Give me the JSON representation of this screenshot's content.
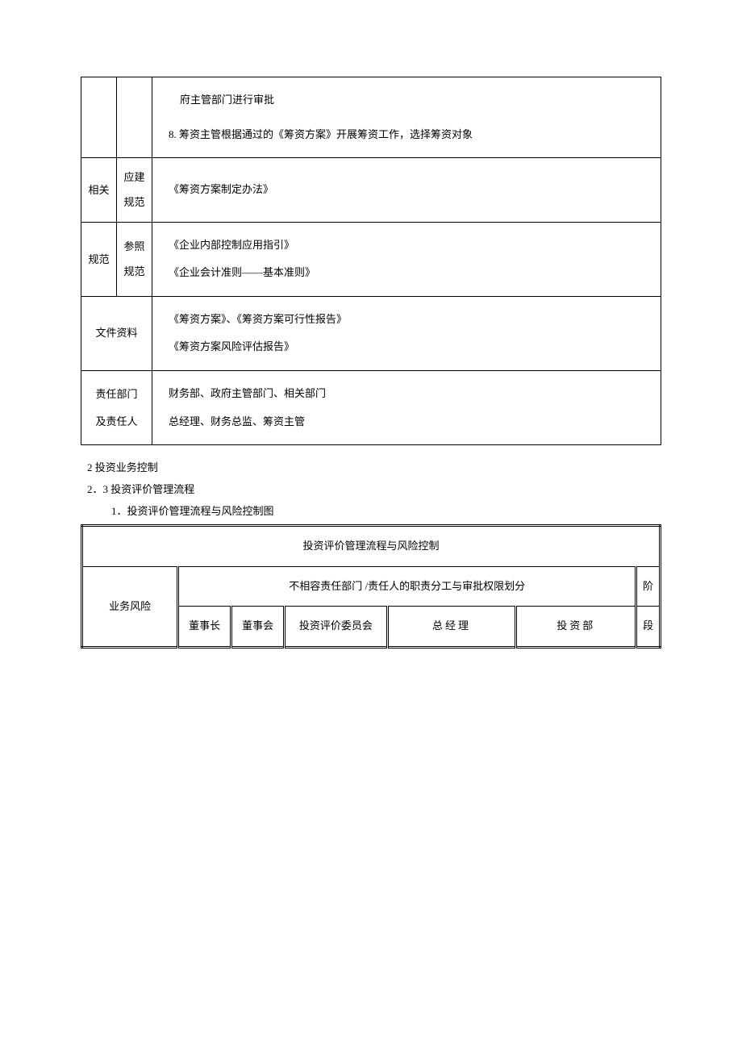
{
  "table1": {
    "row1": {
      "line1": "府主管部门进行审批",
      "line2": "8.  筹资主管根据通过的《筹资方案》开展筹资工作，选择筹资对象"
    },
    "row2": {
      "catA": "相关",
      "catB": "应建规范",
      "content": "《筹资方案制定办法》"
    },
    "row3": {
      "catA": "规范",
      "catB": "参照规范",
      "line1": "《企业内部控制应用指引》",
      "line2": "《企业会计准则——基本准则》"
    },
    "row4": {
      "label": "文件资料",
      "line1": "《筹资方案》、《筹资方案可行性报告》",
      "line2": "《筹资方案风险评估报告》"
    },
    "row5": {
      "label1": "责任部门",
      "content1": "财务部、政府主管部门、相关部门",
      "label2": "及责任人",
      "content2": "总经理、财务总监、筹资主管"
    }
  },
  "sections": {
    "s1": "2    投资业务控制",
    "s2": "2．3   投资评价管理流程",
    "s3": "1．投资评价管理流程与风险控制图"
  },
  "table2": {
    "title": "投资评价管理流程与风险控制",
    "risk_label": "业务风险",
    "header_merged": "不相容责任部门    /责任人的职责分工与审批权限划分",
    "cols": {
      "c1": "董事长",
      "c2": "董事会",
      "c3": "投资评价委员会",
      "c4": "总经理",
      "c5": "投资部"
    },
    "stage_top": "阶",
    "stage_bottom": "段"
  }
}
